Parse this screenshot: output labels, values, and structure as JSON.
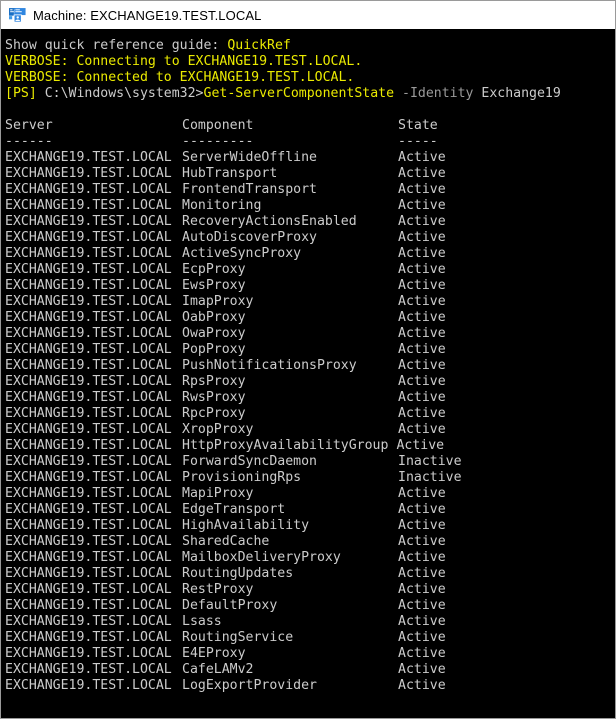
{
  "window": {
    "title": "Machine: EXCHANGE19.TEST.LOCAL",
    "icon": "exchange-management-shell-icon",
    "titlebar_bg": "#ffffff",
    "titlebar_fg": "#000000",
    "console_bg": "#000000"
  },
  "colors": {
    "default_text": "#cccccc",
    "verbose_yellow": "#eaea00",
    "parameter_gray": "#9a9a9a"
  },
  "console": {
    "quickref_line": {
      "prefix": "Show quick reference guide: ",
      "link": "QuickRef"
    },
    "verbose_lines": [
      "VERBOSE: Connecting to EXCHANGE19.TEST.LOCAL.",
      "VERBOSE: Connected to EXCHANGE19.TEST.LOCAL."
    ],
    "prompt": {
      "ps": "[PS]",
      "path": " C:\\Windows\\system32>",
      "command": "Get-ServerComponentState",
      "parameter": " -Identity",
      "argument": " Exchange19"
    },
    "table": {
      "headers": [
        "Server",
        "Component",
        "State"
      ],
      "header_rules": [
        "------",
        "---------",
        "-----"
      ],
      "rows": [
        {
          "server": "EXCHANGE19.TEST.LOCAL",
          "component": "ServerWideOffline",
          "state": "Active"
        },
        {
          "server": "EXCHANGE19.TEST.LOCAL",
          "component": "HubTransport",
          "state": "Active"
        },
        {
          "server": "EXCHANGE19.TEST.LOCAL",
          "component": "FrontendTransport",
          "state": "Active"
        },
        {
          "server": "EXCHANGE19.TEST.LOCAL",
          "component": "Monitoring",
          "state": "Active"
        },
        {
          "server": "EXCHANGE19.TEST.LOCAL",
          "component": "RecoveryActionsEnabled",
          "state": "Active"
        },
        {
          "server": "EXCHANGE19.TEST.LOCAL",
          "component": "AutoDiscoverProxy",
          "state": "Active"
        },
        {
          "server": "EXCHANGE19.TEST.LOCAL",
          "component": "ActiveSyncProxy",
          "state": "Active"
        },
        {
          "server": "EXCHANGE19.TEST.LOCAL",
          "component": "EcpProxy",
          "state": "Active"
        },
        {
          "server": "EXCHANGE19.TEST.LOCAL",
          "component": "EwsProxy",
          "state": "Active"
        },
        {
          "server": "EXCHANGE19.TEST.LOCAL",
          "component": "ImapProxy",
          "state": "Active"
        },
        {
          "server": "EXCHANGE19.TEST.LOCAL",
          "component": "OabProxy",
          "state": "Active"
        },
        {
          "server": "EXCHANGE19.TEST.LOCAL",
          "component": "OwaProxy",
          "state": "Active"
        },
        {
          "server": "EXCHANGE19.TEST.LOCAL",
          "component": "PopProxy",
          "state": "Active"
        },
        {
          "server": "EXCHANGE19.TEST.LOCAL",
          "component": "PushNotificationsProxy",
          "state": "Active"
        },
        {
          "server": "EXCHANGE19.TEST.LOCAL",
          "component": "RpsProxy",
          "state": "Active"
        },
        {
          "server": "EXCHANGE19.TEST.LOCAL",
          "component": "RwsProxy",
          "state": "Active"
        },
        {
          "server": "EXCHANGE19.TEST.LOCAL",
          "component": "RpcProxy",
          "state": "Active"
        },
        {
          "server": "EXCHANGE19.TEST.LOCAL",
          "component": "XropProxy",
          "state": "Active"
        },
        {
          "server": "EXCHANGE19.TEST.LOCAL",
          "component": "HttpProxyAvailabilityGroup",
          "state": "Active",
          "wide": true
        },
        {
          "server": "EXCHANGE19.TEST.LOCAL",
          "component": "ForwardSyncDaemon",
          "state": "Inactive"
        },
        {
          "server": "EXCHANGE19.TEST.LOCAL",
          "component": "ProvisioningRps",
          "state": "Inactive"
        },
        {
          "server": "EXCHANGE19.TEST.LOCAL",
          "component": "MapiProxy",
          "state": "Active"
        },
        {
          "server": "EXCHANGE19.TEST.LOCAL",
          "component": "EdgeTransport",
          "state": "Active"
        },
        {
          "server": "EXCHANGE19.TEST.LOCAL",
          "component": "HighAvailability",
          "state": "Active"
        },
        {
          "server": "EXCHANGE19.TEST.LOCAL",
          "component": "SharedCache",
          "state": "Active"
        },
        {
          "server": "EXCHANGE19.TEST.LOCAL",
          "component": "MailboxDeliveryProxy",
          "state": "Active"
        },
        {
          "server": "EXCHANGE19.TEST.LOCAL",
          "component": "RoutingUpdates",
          "state": "Active"
        },
        {
          "server": "EXCHANGE19.TEST.LOCAL",
          "component": "RestProxy",
          "state": "Active"
        },
        {
          "server": "EXCHANGE19.TEST.LOCAL",
          "component": "DefaultProxy",
          "state": "Active"
        },
        {
          "server": "EXCHANGE19.TEST.LOCAL",
          "component": "Lsass",
          "state": "Active"
        },
        {
          "server": "EXCHANGE19.TEST.LOCAL",
          "component": "RoutingService",
          "state": "Active"
        },
        {
          "server": "EXCHANGE19.TEST.LOCAL",
          "component": "E4EProxy",
          "state": "Active"
        },
        {
          "server": "EXCHANGE19.TEST.LOCAL",
          "component": "CafeLAMv2",
          "state": "Active"
        },
        {
          "server": "EXCHANGE19.TEST.LOCAL",
          "component": "LogExportProvider",
          "state": "Active"
        }
      ]
    }
  }
}
